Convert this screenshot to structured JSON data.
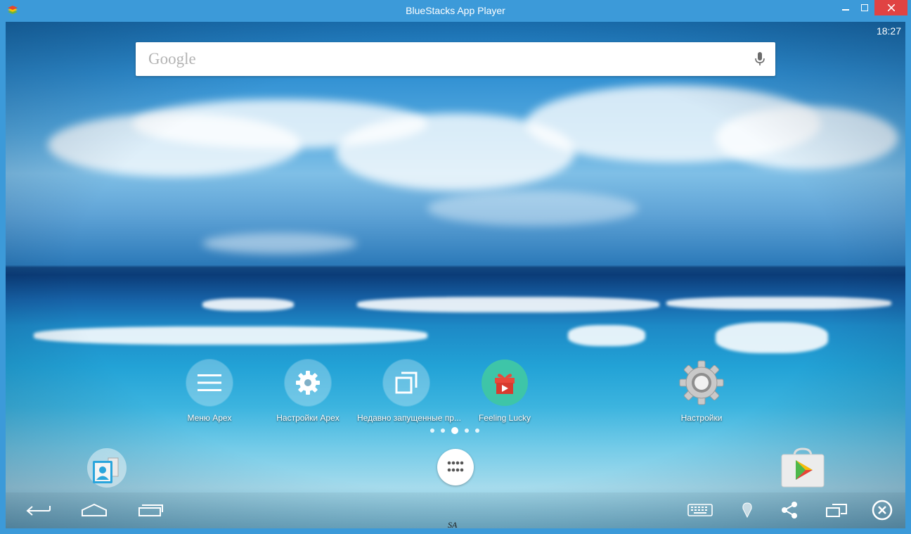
{
  "window": {
    "title": "BlueStacks App Player",
    "minimize_icon": "minimize-icon",
    "maximize_icon": "maximize-icon",
    "close_icon": "close-icon"
  },
  "status_bar": {
    "time": "18:27"
  },
  "search": {
    "logo_text": "Google",
    "mic_icon": "mic-icon"
  },
  "home_apps": [
    {
      "label": "Меню Apex",
      "icon": "menu-icon"
    },
    {
      "label": "Настройки Apex",
      "icon": "gear-icon"
    },
    {
      "label": "Недавно запущенные пр...",
      "icon": "recent-apps-icon"
    },
    {
      "label": "Feeling Lucky",
      "icon": "gift-icon"
    },
    {
      "label": "Настройки",
      "icon": "settings-gear-icon"
    }
  ],
  "page_indicator": {
    "pages": 5,
    "current": 3
  },
  "dock": [
    {
      "name": "contacts",
      "icon": "contacts-icon"
    },
    {
      "name": "app-drawer",
      "icon": "app-drawer-icon"
    },
    {
      "name": "play-store",
      "icon": "play-store-icon"
    }
  ],
  "nav_bar": {
    "left": [
      "back-icon",
      "home-icon",
      "recents-icon"
    ],
    "right": [
      "keyboard-icon",
      "location-icon",
      "share-icon",
      "multiscreen-icon",
      "close-app-icon"
    ]
  },
  "watermark": "SA",
  "colors": {
    "titlebar": "#3c9ad9",
    "close_button": "#e04343",
    "lucky_icon": "#3ec5a8"
  }
}
